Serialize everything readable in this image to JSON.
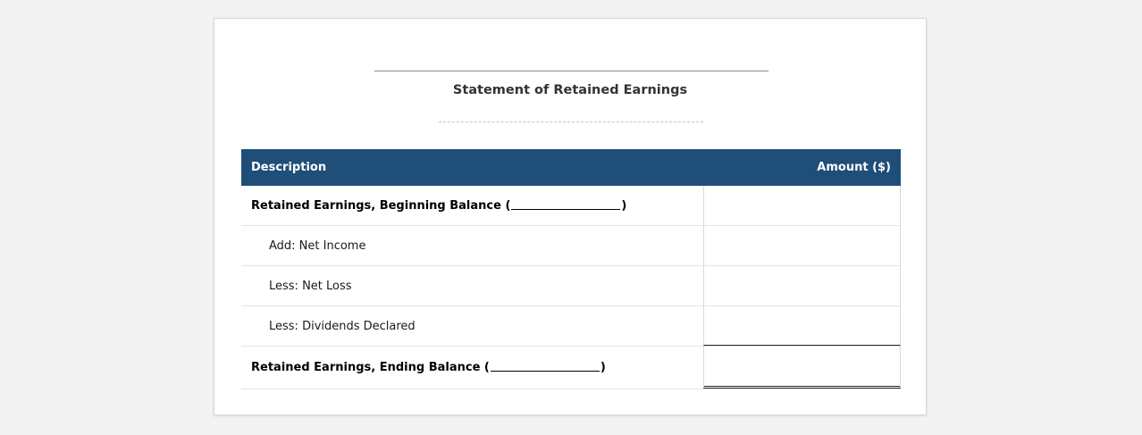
{
  "statement": {
    "title": "Statement of Retained Earnings",
    "columns": {
      "description": "Description",
      "amount": "Amount ($)"
    },
    "rows": [
      {
        "prefix": "Retained Earnings, Beginning Balance (",
        "suffix": ")",
        "amount": ""
      },
      {
        "label": "Add: Net Income",
        "amount": ""
      },
      {
        "label": "Less: Net Loss",
        "amount": ""
      },
      {
        "label": "Less: Dividends Declared",
        "amount": ""
      },
      {
        "prefix": "Retained Earnings, Ending Balance (",
        "suffix": ")",
        "amount": ""
      }
    ]
  }
}
